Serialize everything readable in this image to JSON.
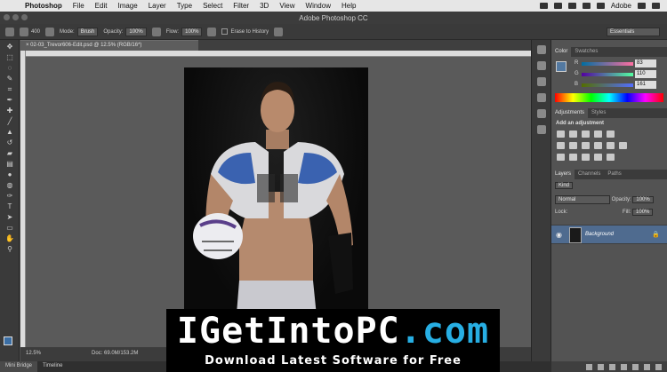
{
  "menubar": {
    "app_name": "Photoshop",
    "items": [
      "File",
      "Edit",
      "Image",
      "Layer",
      "Type",
      "Select",
      "Filter",
      "3D",
      "View",
      "Window",
      "Help"
    ],
    "right_label": "Adobe"
  },
  "window": {
    "title": "Adobe Photoshop CC"
  },
  "options": {
    "brush_size": "400",
    "mode_label": "Mode:",
    "mode_value": "Brush",
    "opacity_label": "Opacity:",
    "opacity_value": "100%",
    "flow_label": "Flow:",
    "flow_value": "100%",
    "erase_history": "Erase to History",
    "workspace": "Essentials"
  },
  "document": {
    "tab_title": "02-03_Trevor606-Edit.psd @ 12.5% (RGB/16*)",
    "zoom": "12.5%",
    "doc_size": "Doc: 69.0M/153.2M"
  },
  "bottom_tabs": [
    "Mini Bridge",
    "Timeline"
  ],
  "color_panel": {
    "tabs": [
      "Color",
      "Swatches"
    ],
    "r": "83",
    "g": "110",
    "b": "161",
    "r_label": "R",
    "g_label": "G",
    "b_label": "B"
  },
  "adjustments_panel": {
    "tabs": [
      "Adjustments",
      "Styles"
    ],
    "title": "Add an adjustment"
  },
  "layers_panel": {
    "tabs": [
      "Layers",
      "Channels",
      "Paths"
    ],
    "kind": "Kind",
    "blend": "Normal",
    "opacity_label": "Opacity:",
    "opacity_value": "100%",
    "lock_label": "Lock:",
    "fill_label": "Fill:",
    "fill_value": "100%",
    "layer_name": "Background"
  },
  "banner": {
    "title_main": "IGetIntoPC",
    "title_ext": ".com",
    "subtitle": "Download Latest Software for Free"
  },
  "colors": {
    "accent": "#4f6b8f",
    "fg_swatch": "#5379a1",
    "banner_blue": "#27aee3"
  }
}
